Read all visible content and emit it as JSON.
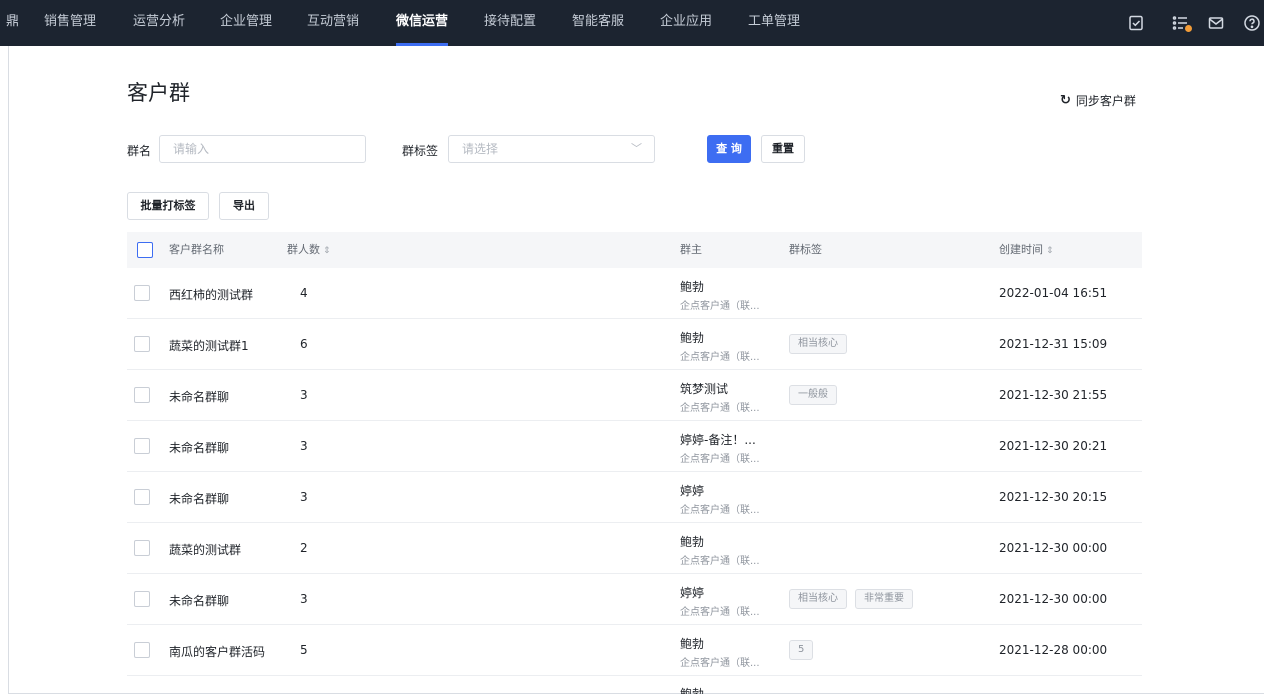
{
  "nav": {
    "edge_label": "鼎",
    "items": [
      "销售管理",
      "运营分析",
      "企业管理",
      "互动营销",
      "微信运营",
      "接待配置",
      "智能客服",
      "企业应用",
      "工单管理"
    ],
    "active": "微信运营"
  },
  "page": {
    "title": "客户群",
    "sync_label": "同步客户群"
  },
  "filters": {
    "group_name_label": "群名",
    "group_name_placeholder": "请输入",
    "tag_label": "群标签",
    "tag_placeholder": "请选择",
    "query_label": "查 询",
    "reset_label": "重置"
  },
  "actions": {
    "batch_tag_label": "批量打标签",
    "export_label": "导出"
  },
  "table": {
    "columns": {
      "name": "客户群名称",
      "members": "群人数",
      "owner": "群主",
      "tags": "群标签",
      "created": "创建时间"
    },
    "rows": [
      {
        "name": "西红柿的测试群",
        "members": "4",
        "owner": "鲍勃",
        "owner_sub": "企点客户通（联...",
        "tags": [],
        "created": "2022-01-04 16:51"
      },
      {
        "name": "蔬菜的测试群1",
        "members": "6",
        "owner": "鲍勃",
        "owner_sub": "企点客户通（联...",
        "tags": [
          "相当核心"
        ],
        "created": "2021-12-31 15:09"
      },
      {
        "name": "未命名群聊",
        "members": "3",
        "owner": "筑梦测试",
        "owner_sub": "企点客户通（联...",
        "tags": [
          "一般般"
        ],
        "created": "2021-12-30 21:55"
      },
      {
        "name": "未命名群聊",
        "members": "3",
        "owner": "婷婷-备注！...",
        "owner_sub": "企点客户通（联...",
        "tags": [],
        "created": "2021-12-30 20:21"
      },
      {
        "name": "未命名群聊",
        "members": "3",
        "owner": "婷婷",
        "owner_sub": "企点客户通（联...",
        "tags": [],
        "created": "2021-12-30 20:15"
      },
      {
        "name": "蔬菜的测试群",
        "members": "2",
        "owner": "鲍勃",
        "owner_sub": "企点客户通（联...",
        "tags": [],
        "created": "2021-12-30 00:00"
      },
      {
        "name": "未命名群聊",
        "members": "3",
        "owner": "婷婷",
        "owner_sub": "企点客户通（联...",
        "tags": [
          "相当核心",
          "非常重要"
        ],
        "created": "2021-12-30 00:00"
      },
      {
        "name": "南瓜的客户群活码",
        "members": "5",
        "owner": "鲍勃",
        "owner_sub": "企点客户通（联...",
        "tags": [
          "5"
        ],
        "created": "2021-12-28 00:00"
      }
    ],
    "partial_row_owner": "鲍勃"
  }
}
